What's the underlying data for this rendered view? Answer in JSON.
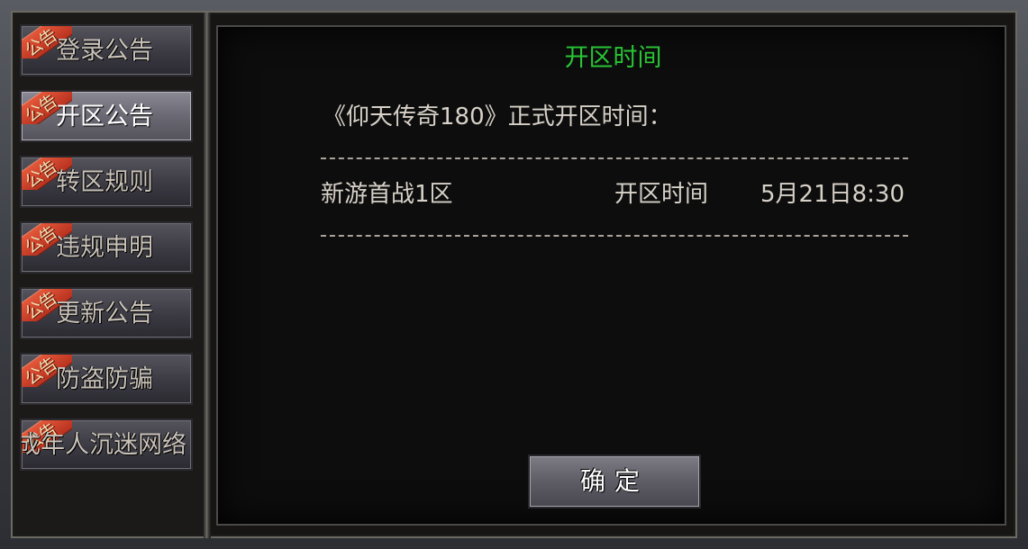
{
  "sidebar": {
    "badge_label": "公告",
    "items": [
      {
        "label": "登录公告",
        "active": false
      },
      {
        "label": "开区公告",
        "active": true
      },
      {
        "label": "转区规则",
        "active": false
      },
      {
        "label": "违规申明",
        "active": false
      },
      {
        "label": "更新公告",
        "active": false
      },
      {
        "label": "防盗防骗",
        "active": false
      },
      {
        "label": "成年人沉迷网络",
        "active": false
      }
    ]
  },
  "panel": {
    "title": "开区时间",
    "headline": "《仰天传奇180》正式开区时间：",
    "rows": [
      {
        "name": "新游首战1区",
        "label": "开区时间",
        "value": "5月21日8:30"
      }
    ],
    "confirm_label": "确定"
  },
  "colors": {
    "title_green": "#29c435",
    "text": "#d7d1c8",
    "badge_red": "#c8402a"
  }
}
